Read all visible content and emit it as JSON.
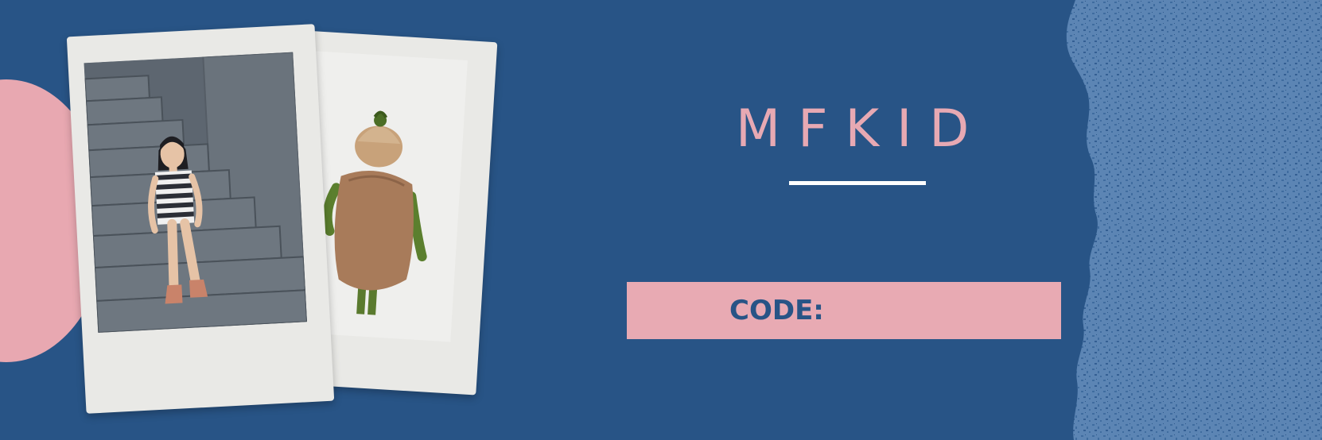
{
  "banner": {
    "brand_name": "MFKID",
    "code_label": "CODE:"
  },
  "photos": [
    {
      "subject": "girl-sitting-on-stairs-photo"
    },
    {
      "subject": "child-in-costume-photo"
    }
  ],
  "colors": {
    "background": "#285486",
    "accent_pink": "#e8a8b1",
    "texture_blue": "#5c85b4",
    "rule_white": "#ffffff"
  }
}
